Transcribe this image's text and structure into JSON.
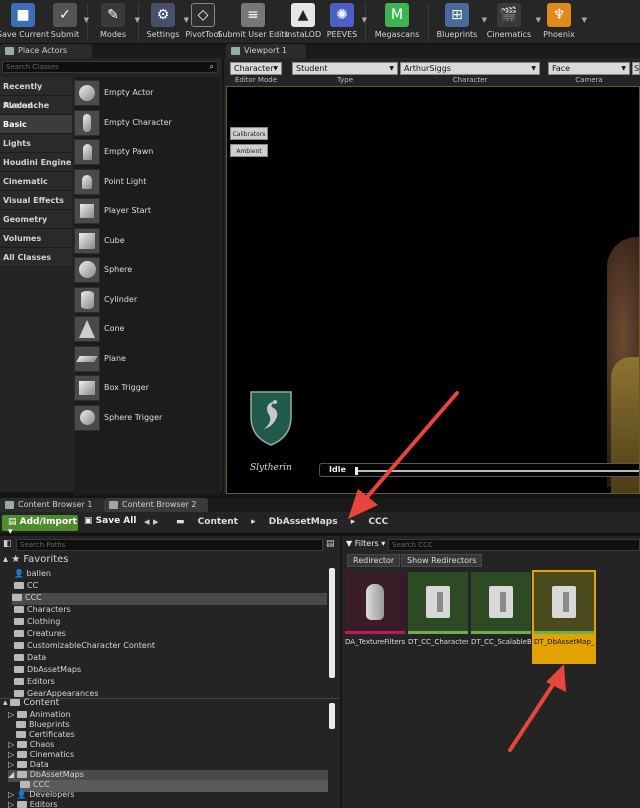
{
  "toolbar": {
    "buttons": [
      {
        "label": "Save Current",
        "icon": "save-icon"
      },
      {
        "label": "Submit",
        "icon": "submit-icon"
      },
      {
        "label": "Modes",
        "icon": "modes-icon"
      },
      {
        "label": "Settings",
        "icon": "settings-icon"
      },
      {
        "label": "PivotTool",
        "icon": "pivot-tool-icon"
      },
      {
        "label": "Submit User Edits",
        "icon": "database-icon"
      },
      {
        "label": "InstaLOD",
        "icon": "instalod-icon"
      },
      {
        "label": "PEEVES",
        "icon": "peeves-icon"
      },
      {
        "label": "Megascans",
        "icon": "megascans-icon"
      },
      {
        "label": "Blueprints",
        "icon": "blueprints-icon"
      },
      {
        "label": "Cinematics",
        "icon": "cinematics-icon"
      },
      {
        "label": "Phoenix",
        "icon": "phoenix-icon"
      }
    ]
  },
  "place_actors": {
    "tab_title": "Place Actors",
    "search_placeholder": "Search Classes",
    "categories": [
      "Recently Placed",
      "Avalanche",
      "Basic",
      "Lights",
      "Houdini Engine",
      "Cinematic",
      "Visual Effects",
      "Geometry",
      "Volumes",
      "All Classes"
    ],
    "selected_category": "Basic",
    "items": [
      "Empty Actor",
      "Empty Character",
      "Empty Pawn",
      "Point Light",
      "Player Start",
      "Cube",
      "Sphere",
      "Cylinder",
      "Cone",
      "Plane",
      "Box Trigger",
      "Sphere Trigger"
    ]
  },
  "viewport": {
    "tab_title": "Viewport 1",
    "dropdowns": [
      {
        "value": "Character",
        "caption": "Editor Mode"
      },
      {
        "value": "Student",
        "caption": "Type"
      },
      {
        "value": "ArthurSiggs",
        "caption": "Character"
      },
      {
        "value": "Face",
        "caption": "Camera"
      },
      {
        "value": "S",
        "caption": ""
      }
    ],
    "buttons": [
      "Calibrators",
      "Ambient"
    ],
    "house": "Slytherin",
    "playback_state": "Idle"
  },
  "content_browser": {
    "tabs": [
      "Content Browser 1",
      "Content Browser 2"
    ],
    "add_import_label": "Add/Import",
    "save_all_label": "Save All",
    "breadcrumbs": [
      "Content",
      "DbAssetMaps",
      "CCC"
    ],
    "path_search_placeholder": "Search Paths",
    "favorites_label": "Favorites",
    "favorites": [
      "ballen",
      "CC",
      "CCC",
      "Characters",
      "Clothing",
      "Creatures",
      "CustomizableCharacter Content",
      "Data",
      "DbAssetMaps",
      "Editors",
      "GearAppearances"
    ],
    "content_label": "Content",
    "content_tree": [
      "Animation",
      "Blueprints",
      "Certificates",
      "Chaos",
      "Cinematics",
      "Data",
      "DbAssetMaps",
      "CCC",
      "Developers",
      "Editors"
    ],
    "filters_label": "Filters",
    "asset_search_placeholder": "Search CCC",
    "filter_chips": [
      "Redirector",
      "Show Redirectors"
    ],
    "assets": [
      {
        "name": "DA_TextureFilters",
        "stripe": "#c2185b"
      },
      {
        "name": "DT_CC_CharacterPieceSubTypeClassication",
        "stripe": "#6ab04c"
      },
      {
        "name": "DT_CC_ScalableBones",
        "stripe": "#6ab04c"
      },
      {
        "name": "DT_DbAssetMap_CharacterPieceDefinition",
        "stripe": "#6ab04c"
      }
    ]
  },
  "colors": {
    "accent": "#e2a300",
    "add_button": "#4f8c2f",
    "annotation_arrow": "#e8453c"
  }
}
